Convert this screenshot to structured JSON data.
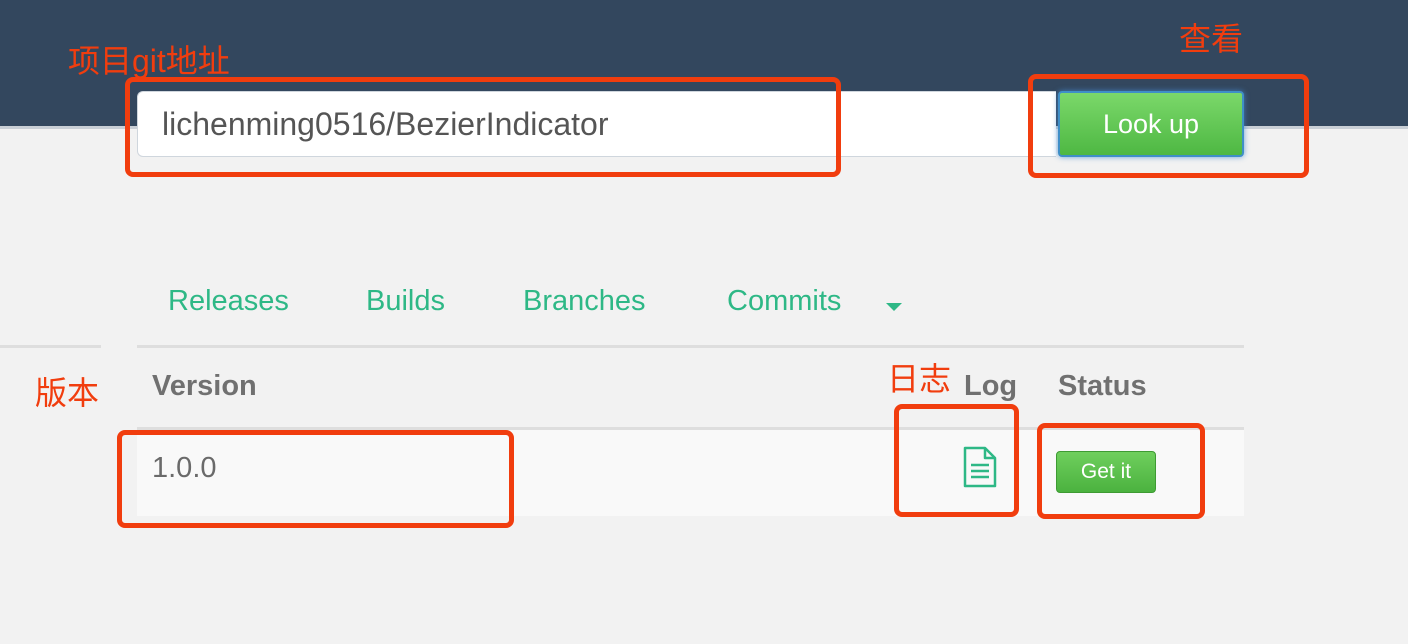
{
  "header": {
    "repo_input_value": "lichenming0516/BezierIndicator",
    "lookup_label": "Look up"
  },
  "tabs": [
    {
      "label": "Releases"
    },
    {
      "label": "Builds"
    },
    {
      "label": "Branches"
    },
    {
      "label": "Commits"
    }
  ],
  "table": {
    "columns": {
      "version": "Version",
      "log": "Log",
      "status": "Status"
    },
    "rows": [
      {
        "version": "1.0.0",
        "log_icon": "document-icon",
        "status_label": "Get it"
      }
    ]
  },
  "annotations": {
    "repo": "项目git地址",
    "lookup": "查看",
    "version": "版本",
    "log": "日志"
  },
  "colors": {
    "header": "#33475e",
    "accent": "#2eb886",
    "button": "#5cbf4d",
    "annotation": "#f13d0e"
  }
}
